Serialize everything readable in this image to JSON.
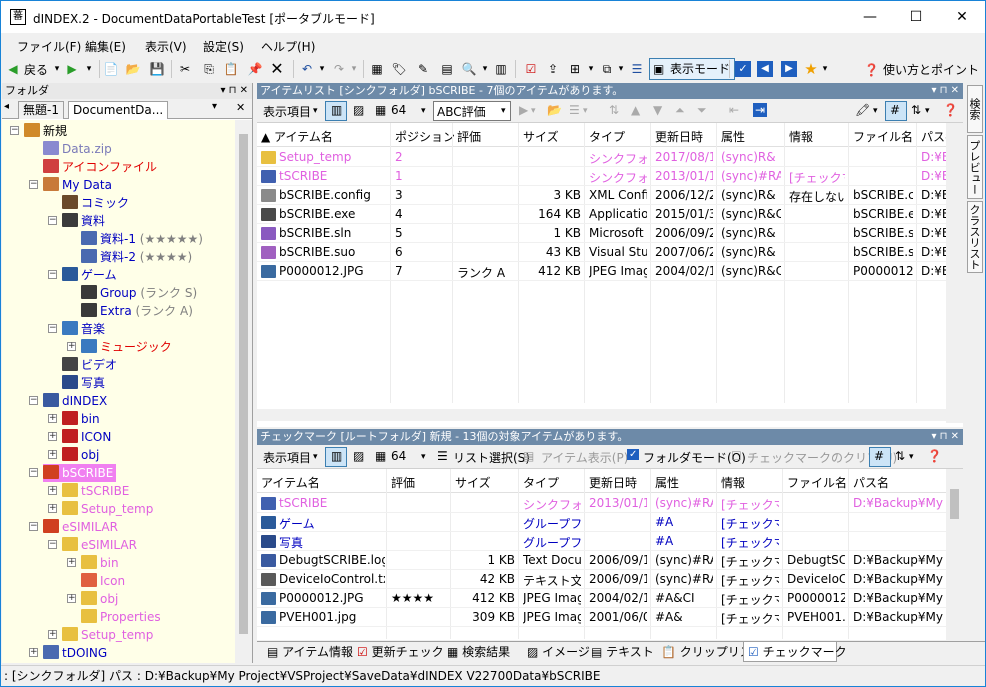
{
  "window": {
    "title": "dINDEX.2 - DocumentDataPortableTest [ポータブルモード]",
    "minimize": "—",
    "maximize": "☐",
    "close": "✕"
  },
  "menu": [
    "ファイル(F)",
    "編集(E)",
    "表示(V)",
    "設定(S)",
    "ヘルプ(H)"
  ],
  "toolbar": {
    "back_label": "戻る",
    "mode_label": "表示モード",
    "help_label": "使い方とポイント"
  },
  "folder_pane": {
    "title": "フォルダ",
    "tabs": [
      "無題-1",
      "DocumentDa..."
    ],
    "tree": [
      {
        "label": "新規",
        "color": "#000000",
        "icon": "home-icon"
      },
      {
        "label": "Data.zip",
        "color": "#7a7ab8",
        "icon": "zip-icon"
      },
      {
        "label": "アイコンファイル",
        "color": "#e00000",
        "icon": "icon-file-icon"
      },
      {
        "label": "My Data",
        "color": "#0000c0",
        "icon": "folder-data-icon"
      },
      {
        "label": "コミック",
        "color": "#0000c0",
        "icon": "comic-icon"
      },
      {
        "label": "資料",
        "color": "#0000c0",
        "icon": "book-icon"
      },
      {
        "label": "資料-1",
        "suffix": "(★★★★★)",
        "color": "#0000c0",
        "icon": "document-icon"
      },
      {
        "label": "資料-2",
        "suffix": "(★★★★)",
        "color": "#0000c0",
        "icon": "document-icon"
      },
      {
        "label": "ゲーム",
        "color": "#0000c0",
        "icon": "game-icon"
      },
      {
        "label": "Group",
        "suffix": "(ランク S)",
        "color": "#0000c0",
        "icon": "book-icon"
      },
      {
        "label": "Extra",
        "suffix": "(ランク A)",
        "color": "#0000c0",
        "icon": "book-icon"
      },
      {
        "label": "音楽",
        "color": "#0000c0",
        "icon": "music-icon"
      },
      {
        "label": "ミュージック",
        "color": "#e00000",
        "icon": "music-icon"
      },
      {
        "label": "ビデオ",
        "color": "#0000c0",
        "icon": "video-icon"
      },
      {
        "label": "写真",
        "color": "#0000c0",
        "icon": "photo-icon"
      },
      {
        "label": "dINDEX",
        "color": "#0000c0",
        "icon": "dindex-icon"
      },
      {
        "label": "bin",
        "color": "#0000c0",
        "icon": "red-book-icon"
      },
      {
        "label": "ICON",
        "color": "#0000c0",
        "icon": "red-book-icon"
      },
      {
        "label": "obj",
        "color": "#0000c0",
        "icon": "red-book-icon"
      },
      {
        "label": "bSCRIBE",
        "color": "#ffffff",
        "icon": "sync-folder-icon"
      },
      {
        "label": "tSCRIBE",
        "color": "#e060e0",
        "icon": "folder-icon"
      },
      {
        "label": "Setup_temp",
        "color": "#e060e0",
        "icon": "folder-icon"
      },
      {
        "label": "eSIMILAR",
        "color": "#e060e0",
        "icon": "sync-folder-icon"
      },
      {
        "label": "eSIMILAR",
        "color": "#e060e0",
        "icon": "folder-icon"
      },
      {
        "label": "bin",
        "color": "#e060e0",
        "icon": "folder-icon"
      },
      {
        "label": "Icon",
        "color": "#e060e0",
        "icon": "folder-error-icon"
      },
      {
        "label": "obj",
        "color": "#e060e0",
        "icon": "folder-icon"
      },
      {
        "label": "Properties",
        "color": "#e060e0",
        "icon": "folder-icon"
      },
      {
        "label": "Setup_temp",
        "color": "#e060e0",
        "icon": "folder-icon"
      },
      {
        "label": "tDOING",
        "color": "#0000c0",
        "icon": "document-icon"
      }
    ]
  },
  "item_list": {
    "header": "アイテムリスト [シンクフォルダ] bSCRIBE - 7個のアイテムがあります。",
    "toolbar": {
      "view_label": "表示項目",
      "size_label": "64",
      "rating_label": "ABC評価"
    },
    "columns": [
      "▲ アイテム名",
      "ポジション",
      "評価",
      "サイズ",
      "タイプ",
      "更新日時",
      "属性",
      "情報",
      "ファイル名",
      "パス名"
    ],
    "rows": [
      {
        "name": "Setup_temp",
        "pos": "2",
        "rating": "",
        "size": "",
        "type": "シンクフォルダ",
        "date": "2017/08/11 (",
        "attr": "(sync)R&",
        "info": "",
        "file": "",
        "path": "D:¥Backu",
        "color": "#e060e0"
      },
      {
        "name": "tSCRIBE",
        "pos": "1",
        "rating": "",
        "size": "",
        "type": "シンクフォルダ",
        "date": "2013/01/13 (",
        "attr": "(sync)#RA&",
        "info": "[チェックマーク",
        "file": "",
        "path": "D:¥Backu",
        "color": "#e060e0"
      },
      {
        "name": "bSCRIBE.config",
        "pos": "3",
        "rating": "",
        "size": "3 KB",
        "type": "XML Config",
        "date": "2006/12/26",
        "attr": "(sync)R&",
        "info": "存在しない:",
        "file": "bSCRIBE.cor",
        "path": "D:¥Backu",
        "color": "#000000"
      },
      {
        "name": "bSCRIBE.exe",
        "pos": "4",
        "rating": "",
        "size": "164 KB",
        "type": "Application",
        "date": "2015/01/31",
        "attr": "(sync)R&CI",
        "info": "",
        "file": "bSCRIBE.exe",
        "path": "D:¥Backu",
        "color": "#000000"
      },
      {
        "name": "bSCRIBE.sln",
        "pos": "5",
        "rating": "",
        "size": "1 KB",
        "type": "Microsoft Vi",
        "date": "2006/09/26",
        "attr": "(sync)R&",
        "info": "",
        "file": "bSCRIBE.sln",
        "path": "D:¥Backu",
        "color": "#000000"
      },
      {
        "name": "bSCRIBE.suo",
        "pos": "6",
        "rating": "",
        "size": "43 KB",
        "type": "Visual Studi",
        "date": "2007/06/24",
        "attr": "(sync)R&",
        "info": "",
        "file": "bSCRIBE.suc",
        "path": "D:¥Backu",
        "color": "#000000"
      },
      {
        "name": "P0000012.JPG",
        "pos": "7",
        "rating": "ランク A",
        "size": "412 KB",
        "type": "JPEG Image",
        "date": "2004/02/16",
        "attr": "(sync)R&CI",
        "info": "",
        "file": "P0000012.JP",
        "path": "D:¥Backu",
        "color": "#000000"
      }
    ]
  },
  "checkmark_list": {
    "header": "チェックマーク [ルートフォルダ] 新規 - 13個の対象アイテムがあります。",
    "toolbar": {
      "view_label": "表示項目",
      "size_label": "64",
      "list_select": "リスト選択(S)",
      "item_view": "アイテム表示(P)",
      "folder_mode": "フォルダモード(O)",
      "clear_marks": "チェックマークのクリア(U)"
    },
    "columns": [
      "アイテム名",
      "評価",
      "サイズ",
      "タイプ",
      "更新日時",
      "属性",
      "情報",
      "ファイル名",
      "パス名"
    ],
    "rows": [
      {
        "name": "tSCRIBE",
        "rating": "",
        "size": "",
        "type": "シンクフォルダ",
        "date": "2013/01/13 (",
        "attr": "(sync)#RA&",
        "info": "[チェックマーク",
        "file": "",
        "path": "D:¥Backup¥My Pr",
        "color": "#e060e0"
      },
      {
        "name": "ゲーム",
        "rating": "",
        "size": "",
        "type": "グループフォル",
        "date": "",
        "attr": "#A",
        "info": "[チェックマーク",
        "file": "",
        "path": "",
        "color": "#0000c0"
      },
      {
        "name": "写真",
        "rating": "",
        "size": "",
        "type": "グループフォル",
        "date": "",
        "attr": "#A",
        "info": "[チェックマーク",
        "file": "",
        "path": "",
        "color": "#0000c0"
      },
      {
        "name": "DebugtSCRIBE.log",
        "rating": "",
        "size": "1 KB",
        "type": "Text Docum",
        "date": "2006/09/13",
        "attr": "(sync)#RA&",
        "info": "[チェックマーク",
        "file": "DebugtSCRI",
        "path": "D:¥Backup¥My Pr",
        "color": "#000000"
      },
      {
        "name": "DeviceIoControl.txt",
        "rating": "",
        "size": "42 KB",
        "type": "テキスト文書",
        "date": "2006/09/16",
        "attr": "(sync)#RA&",
        "info": "[チェックマーク",
        "file": "DeviceIoCor",
        "path": "D:¥Backup¥My Pr",
        "color": "#000000"
      },
      {
        "name": "P0000012.JPG",
        "rating": "★★★★",
        "size": "412 KB",
        "type": "JPEG Image",
        "date": "2004/02/16",
        "attr": "#A&CI",
        "info": "[チェックマーク",
        "file": "P0000012.JP",
        "path": "D:¥Backup¥My Pr",
        "color": "#000000"
      },
      {
        "name": "PVEH001.jpg",
        "rating": "",
        "size": "309 KB",
        "type": "JPEG Image",
        "date": "2001/06/02",
        "attr": "#A&",
        "info": "[チェックマーク",
        "file": "PVEH001.jpc",
        "path": "D:¥Backup¥My Pr",
        "color": "#000000"
      }
    ]
  },
  "side_tabs": [
    "検索",
    "プレビュー",
    "クラスリスト"
  ],
  "bottom_tabs": [
    "アイテム情報",
    "更新チェック",
    "検索結果",
    "イメージ",
    "テキスト",
    "クリップリスト",
    "チェックマーク"
  ],
  "status": ": [シンクフォルダ] パス : D:¥Backup¥My Project¥VSProject¥SaveData¥dINDEX V22700Data¥bSCRIBE",
  "colors": {
    "accent": "#1883d7",
    "pane_header": "#6d8aa8",
    "tree_bg": "#ffffe8",
    "selected_bg": "#f080f0",
    "link_blue": "#0000c0",
    "pink": "#e060e0"
  }
}
